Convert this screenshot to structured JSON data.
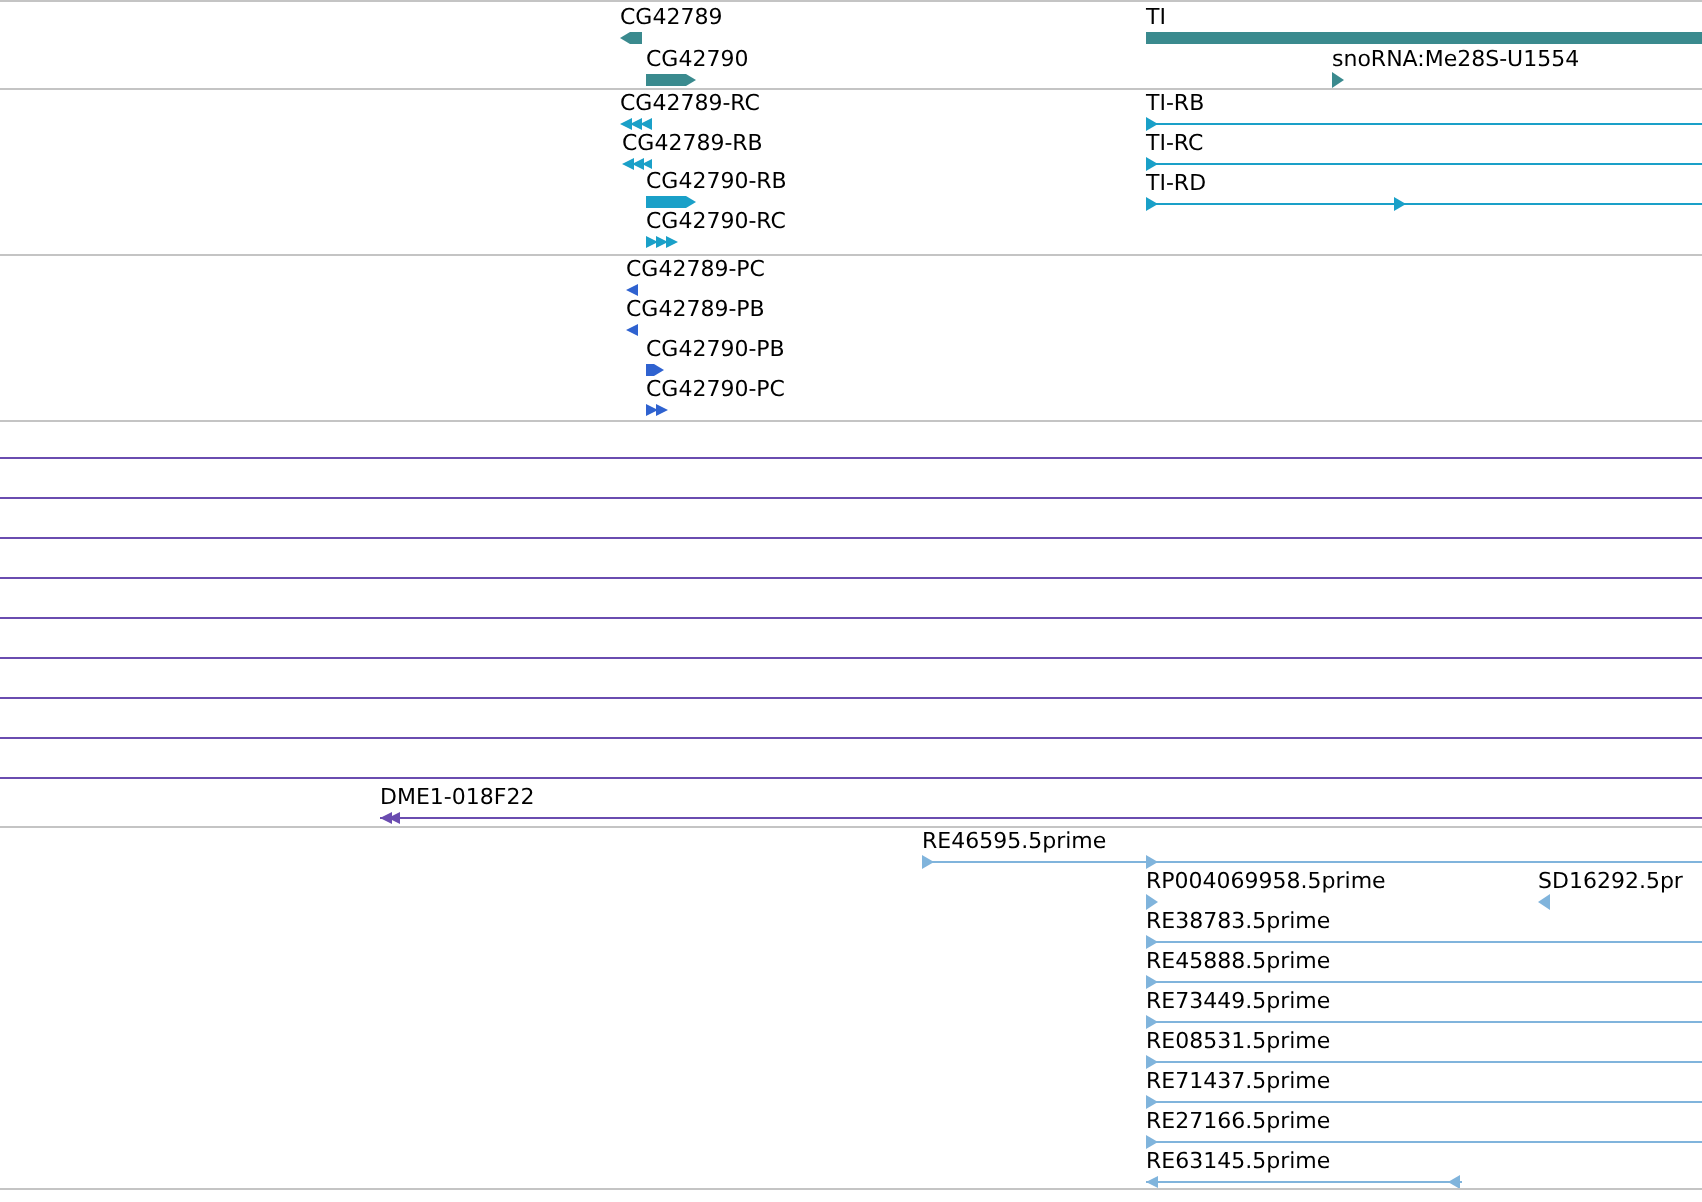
{
  "tracks": [
    {
      "color": "#3a8a8e",
      "features": [
        {
          "label": "CG42789",
          "kind": "block",
          "reverse": true
        },
        {
          "label": "CG42790",
          "kind": "block",
          "reverse": false
        },
        {
          "label": "TI",
          "kind": "block",
          "reverse": false
        },
        {
          "label": "snoRNA:Me28S-U1554",
          "kind": "tick",
          "reverse": false
        }
      ]
    },
    {
      "color": "#1aa0c8",
      "features": [
        {
          "label": "CG42789-RC",
          "kind": "arrows",
          "reverse": true
        },
        {
          "label": "CG42789-RB",
          "kind": "arrows",
          "reverse": true
        },
        {
          "label": "CG42790-RB",
          "kind": "block",
          "reverse": false
        },
        {
          "label": "CG42790-RC",
          "kind": "arrows",
          "reverse": false
        },
        {
          "label": "TI-RB",
          "kind": "line",
          "reverse": false
        },
        {
          "label": "TI-RC",
          "kind": "line",
          "reverse": false
        },
        {
          "label": "TI-RD",
          "kind": "line",
          "reverse": false
        }
      ]
    },
    {
      "color": "#2f62d0",
      "features": [
        {
          "label": "CG42789-PC",
          "kind": "arrows",
          "reverse": true
        },
        {
          "label": "CG42789-PB",
          "kind": "arrows",
          "reverse": true
        },
        {
          "label": "CG42790-PB",
          "kind": "block",
          "reverse": false
        },
        {
          "label": "CG42790-PC",
          "kind": "arrows",
          "reverse": false
        }
      ]
    },
    {
      "color": "#6a4cb0",
      "features": [
        {
          "kind": "line"
        },
        {
          "kind": "line"
        },
        {
          "kind": "line"
        },
        {
          "kind": "line"
        },
        {
          "kind": "line"
        },
        {
          "kind": "line"
        },
        {
          "kind": "line"
        },
        {
          "kind": "line"
        },
        {
          "kind": "line"
        },
        {
          "label": "DME1-018F22",
          "kind": "line",
          "reverse": true
        }
      ]
    },
    {
      "color": "#80b4dc",
      "features": [
        {
          "label": "RE46595.5prime",
          "kind": "line",
          "reverse": false
        },
        {
          "label": "RP004069958.5prime",
          "kind": "tick",
          "reverse": false
        },
        {
          "label": "SD16292.5pr",
          "kind": "tick",
          "reverse": true
        },
        {
          "label": "RE38783.5prime",
          "kind": "line",
          "reverse": false
        },
        {
          "label": "RE45888.5prime",
          "kind": "line",
          "reverse": false
        },
        {
          "label": "RE73449.5prime",
          "kind": "line",
          "reverse": false
        },
        {
          "label": "RE08531.5prime",
          "kind": "line",
          "reverse": false
        },
        {
          "label": "RE71437.5prime",
          "kind": "line",
          "reverse": false
        },
        {
          "label": "RE27166.5prime",
          "kind": "line",
          "reverse": false
        },
        {
          "label": "RE63145.5prime",
          "kind": "line",
          "reverse": true
        }
      ]
    }
  ]
}
